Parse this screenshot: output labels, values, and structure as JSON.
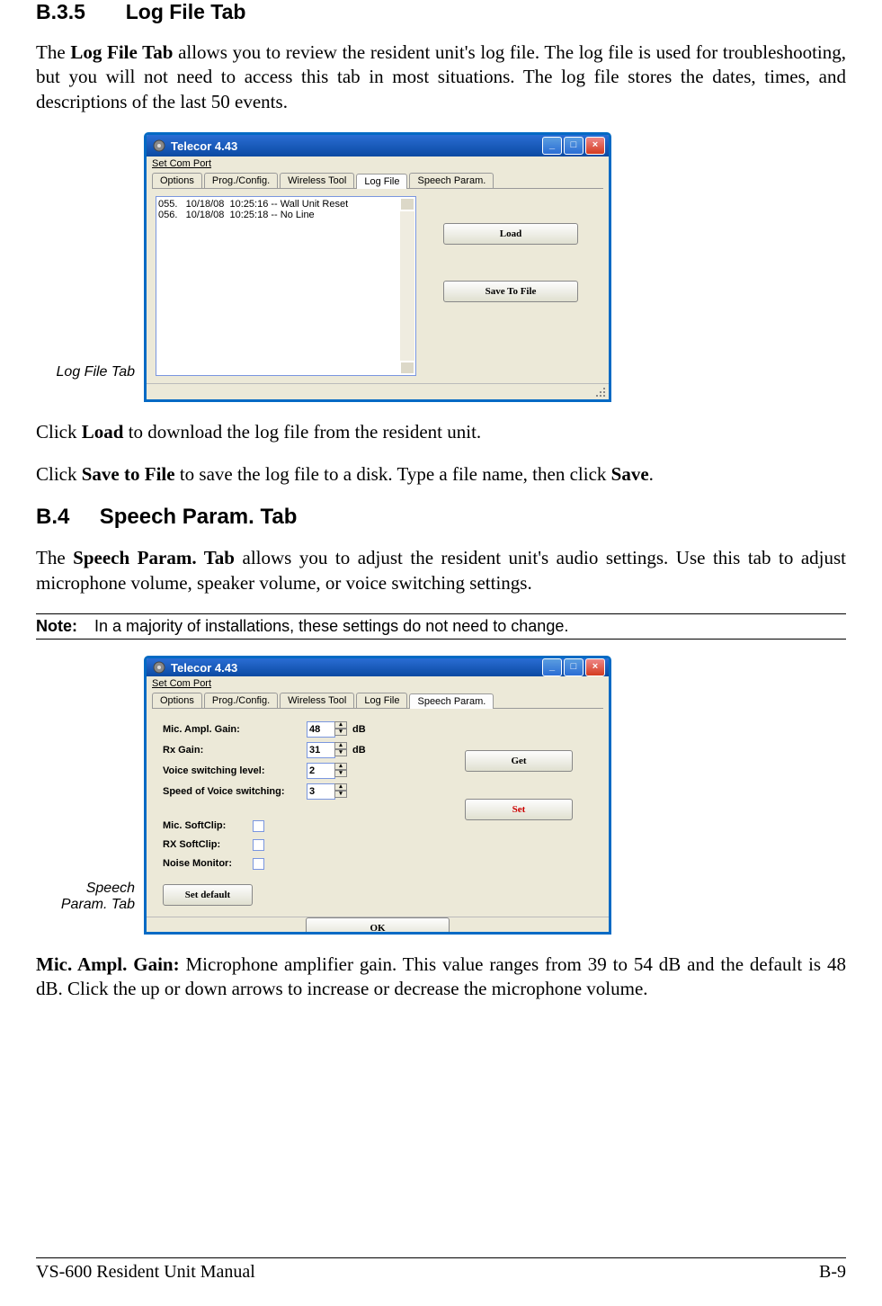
{
  "doc": {
    "h_b35_num": "B.3.5",
    "h_b35_title": "Log File Tab",
    "p1a": "The ",
    "p1b": "Log File Tab",
    "p1c": " allows you to review the resident unit's log file.  The log file is used for troubleshooting, but you will not need to access this tab in most situations.  The log file stores the dates, times, and descriptions of the last 50 events.",
    "side_label_1": "Log File Tab",
    "p2a": "Click ",
    "p2b": "Load",
    "p2c": " to download the log file from the resident unit.",
    "p3a": "Click ",
    "p3b": "Save to File",
    "p3c": " to save the log file to a disk.  Type a file name, then click ",
    "p3d": "Save",
    "p3e": ".",
    "h_b4_num": "B.4",
    "h_b4_title": "Speech Param. Tab",
    "p4a": "The ",
    "p4b": "Speech Param. Tab",
    "p4c": " allows you to adjust the resident unit's audio settings.  Use this tab to adjust microphone volume, speaker volume, or voice switching settings.",
    "note_label": "Note:",
    "note_text": "In a majority of installations, these settings do not need to change.",
    "side_label_2": "Speech Param. Tab",
    "p5a": "Mic. Ampl. Gain:",
    "p5b": " Microphone amplifier gain.  This value ranges from 39 to 54 dB and the default is 48 dB.  Click the up or down arrows to increase or decrease the microphone volume.",
    "footer_left": "VS-600 Resident Unit Manual",
    "footer_right": "B-9"
  },
  "win": {
    "title": "Telecor 4.43",
    "menu_item": "Set Com Port",
    "menu_underline": "S",
    "tabs": [
      "Options",
      "Prog./Config.",
      "Wireless Tool",
      "Log File",
      "Speech Param."
    ],
    "logline1": "055.   10/18/08  10:25:16 -- Wall Unit Reset",
    "logline2": "056.   10/18/08  10:25:18 -- No Line",
    "btn_load": "Load",
    "btn_save": "Save To File",
    "form": {
      "mic_label": "Mic. Ampl. Gain:",
      "mic_val": "48",
      "mic_unit": "dB",
      "rx_label": "Rx Gain:",
      "rx_val": "31",
      "rx_unit": "dB",
      "vsl_label": "Voice switching level:",
      "vsl_val": "2",
      "svs_label": "Speed of Voice switching:",
      "svs_val": "3",
      "chk1": "Mic.  SoftClip:",
      "chk2": "RX    SoftClip:",
      "chk3": "Noise Monitor:",
      "btn_get": "Get",
      "btn_set": "Set",
      "btn_default": "Set default",
      "btn_ok": "OK"
    }
  }
}
